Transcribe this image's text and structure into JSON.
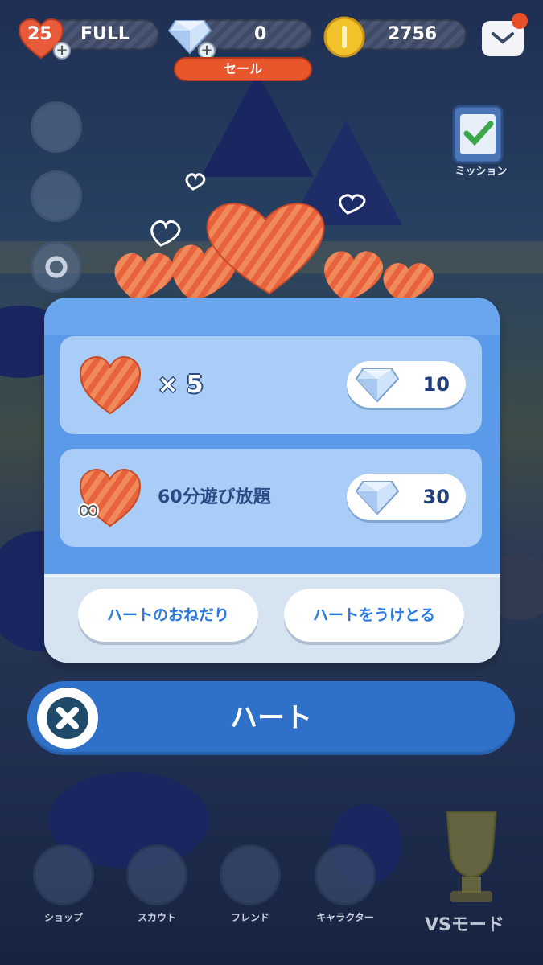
{
  "topbar": {
    "hearts_count": "25",
    "hearts_status": "FULL",
    "gems_count": "0",
    "coins_count": "2756",
    "sale_label": "セール"
  },
  "side": {
    "mission_label": "ミッション"
  },
  "modal": {
    "rows": [
      {
        "label": "× 5",
        "price": "10"
      },
      {
        "label": "60分遊び放題",
        "price": "30"
      }
    ],
    "footer": {
      "request_label": "ハートのおねだり",
      "receive_label": "ハートをうけとる"
    }
  },
  "titlebar": {
    "title": "ハート"
  },
  "bottom_nav": {
    "items": [
      {
        "label": "ショップ"
      },
      {
        "label": "スカウト"
      },
      {
        "label": "フレンド"
      },
      {
        "label": "キャラクター"
      }
    ],
    "vs_label": "VSモード"
  },
  "colors": {
    "accent_blue": "#2f70c8",
    "modal_blue": "#5a9ae8",
    "row_blue": "#a9cdf6",
    "sale_red": "#e8562c",
    "heart_red": "#e85a3a"
  },
  "icons": [
    "heart-icon",
    "gem-icon",
    "coin-icon",
    "mail-icon",
    "plus-icon",
    "compass-icon",
    "megaphone-icon",
    "gear-icon",
    "mission-clipboard-icon",
    "infinity-icon",
    "close-icon",
    "shop-icon",
    "scout-icon",
    "friend-icon",
    "character-icon",
    "trophy-icon"
  ]
}
